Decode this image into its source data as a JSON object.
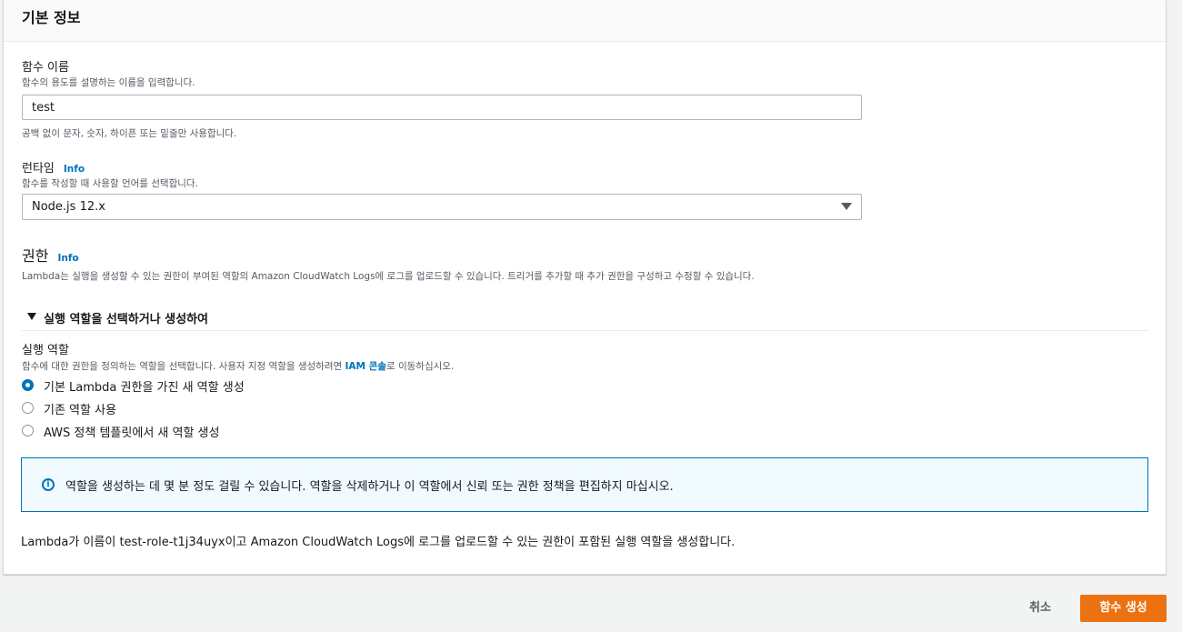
{
  "basic_info": {
    "title": "기본 정보",
    "function_name": {
      "label": "함수 이름",
      "description": "함수의 용도를 설명하는 이름을 입력합니다.",
      "value": "test",
      "constraint": "공백 없이 문자, 숫자, 하이픈 또는 밑줄만 사용합니다."
    },
    "runtime": {
      "label": "런타임",
      "info": "Info",
      "description": "함수를 작성할 때 사용할 언어를 선택합니다.",
      "selected": "Node.js 12.x"
    }
  },
  "permissions": {
    "heading": "권한",
    "info": "Info",
    "description": "Lambda는 실행을 생성할 수 있는 권한이 부여된 역할의 Amazon CloudWatch Logs에 로그를 업로드할 수 있습니다. 트리거를 추가할 때 추가 권한을 구성하고 수정할 수 있습니다.",
    "expander_label": "실행 역할을 선택하거나 생성하여",
    "execution_role": {
      "label": "실행 역할",
      "description_before": "함수에 대한 권한을 정의하는 역할을 선택합니다. 사용자 지정 역할을 생성하려면 ",
      "description_link": "IAM 콘솔",
      "description_after": "로 이동하십시오.",
      "options": [
        {
          "label": "기본 Lambda 권한을 가진 새 역할 생성",
          "checked": true
        },
        {
          "label": "기존 역할 사용",
          "checked": false
        },
        {
          "label": "AWS 정책 템플릿에서 새 역할 생성",
          "checked": false
        }
      ]
    },
    "alert_text": "역할을 생성하는 데 몇 분 정도 걸릴 수 있습니다. 역할을 삭제하거나 이 역할에서 신뢰 또는 권한 정책을 편집하지 마십시오.",
    "summary": "Lambda가 이름이 test-role-t1j34uyx이고 Amazon CloudWatch Logs에 로그를 업로드할 수 있는 권한이 포함된 실행 역할을 생성합니다."
  },
  "actions": {
    "cancel": "취소",
    "create": "함수 생성"
  },
  "colors": {
    "primary_button": "#ec7211",
    "link": "#0073bb",
    "alert_background": "#f1faff"
  }
}
